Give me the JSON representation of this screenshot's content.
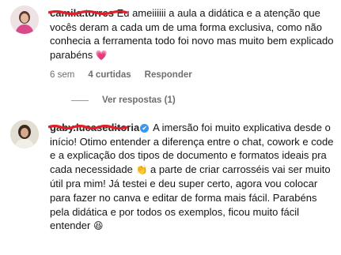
{
  "comments": [
    {
      "username": "camila.torres",
      "text": "Eu ameiiiiii a aula a didática e a atenção que vocês deram a cada um de uma forma exclusiva, como não conhecia a ferramenta todo foi novo mas muito bem explicado parabéns",
      "emoji": "💗",
      "age": "6 sem",
      "likes": "4 curtidas",
      "reply_label": "Responder",
      "view_replies": "Ver respostas (1)"
    },
    {
      "username": "gaby.lucaseditoria",
      "verified": "✔",
      "text_before_emoji": "A imersão foi muito explicativa desde o início! Otimo entender a diferença entre o chat, cowork e code e a explicação dos tipos de documento e formatos ideais pra cada necessidade",
      "mid_emoji": "👏",
      "text_after_emoji": "a parte de criar carrosséis vai ser muito útil pra mim! Já testei e deu super certo, agora vou colocar para fazer no canva e editar de forma mais fácil. Parabéns pela didática e por todos os exemplos, ficou muito fácil entender",
      "end_emoji": "😆"
    }
  ],
  "colors": {
    "text": "#141414",
    "meta": "#6e6e6e",
    "scribble": "#e0202a",
    "verified": "#3897f0"
  }
}
